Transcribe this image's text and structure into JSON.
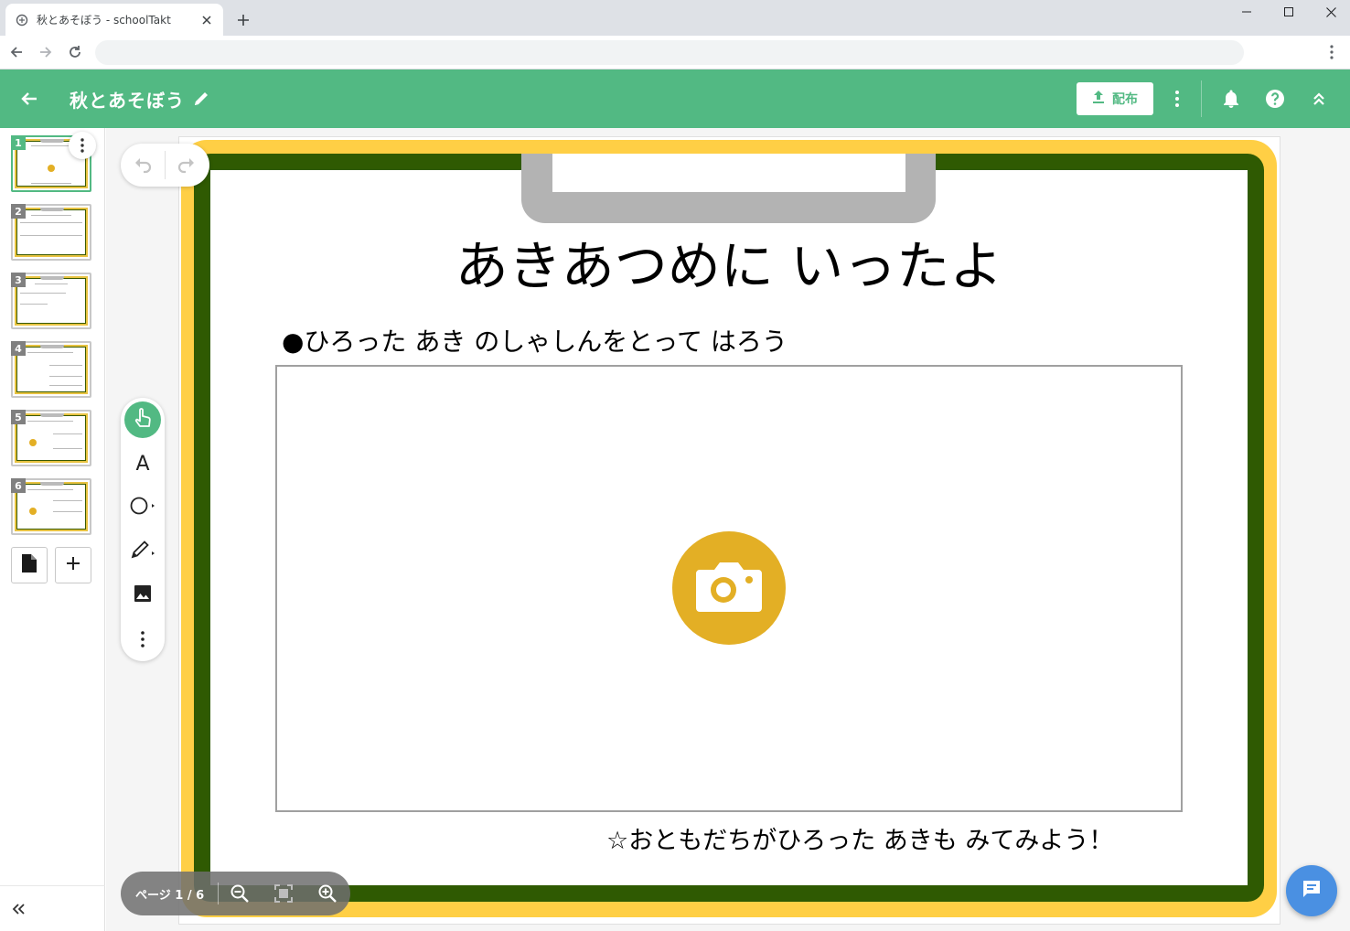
{
  "browser": {
    "tab_title": "秋とあそぼう - schoolTakt",
    "address": ""
  },
  "app": {
    "title": "秋とあそぼう",
    "distribute_label": "配布",
    "accent_color": "#52b983"
  },
  "sidebar": {
    "thumbnails": [
      {
        "number": "1",
        "active": true
      },
      {
        "number": "2",
        "active": false
      },
      {
        "number": "3",
        "active": false
      },
      {
        "number": "4",
        "active": false
      },
      {
        "number": "5",
        "active": false
      },
      {
        "number": "6",
        "active": false
      }
    ]
  },
  "slide": {
    "title": "あきあつめに いったよ",
    "instruction": "●ひろった あき のしゃしんをとって はろう",
    "footer": "☆おともだちがひろった あきも みてみよう！"
  },
  "zoom": {
    "page_label": "ページ 1 / 6"
  },
  "tools": {
    "text_tool_label": "A"
  }
}
